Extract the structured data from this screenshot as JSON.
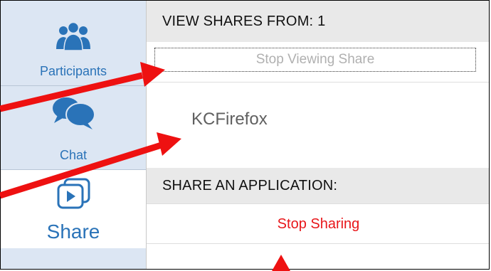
{
  "sidebar": {
    "items": [
      {
        "label": "Participants",
        "icon": "participants-icon"
      },
      {
        "label": "Chat",
        "icon": "chat-bubbles-icon"
      },
      {
        "label": "Share",
        "icon": "share-screen-icon"
      }
    ]
  },
  "panel": {
    "view_shares_header": "VIEW SHARES FROM: 1",
    "stop_viewing_label": "Stop Viewing Share",
    "share_item_name": "KCFirefox",
    "share_app_header": "SHARE AN APPLICATION:",
    "stop_sharing_label": "Stop Sharing"
  },
  "colors": {
    "accent_blue": "#2a73b8",
    "sidebar_active_bg": "#dce6f3",
    "header_bg": "#e9e9e9",
    "stop_sharing_red": "#e8161a",
    "annotation_red": "#ee1111"
  }
}
